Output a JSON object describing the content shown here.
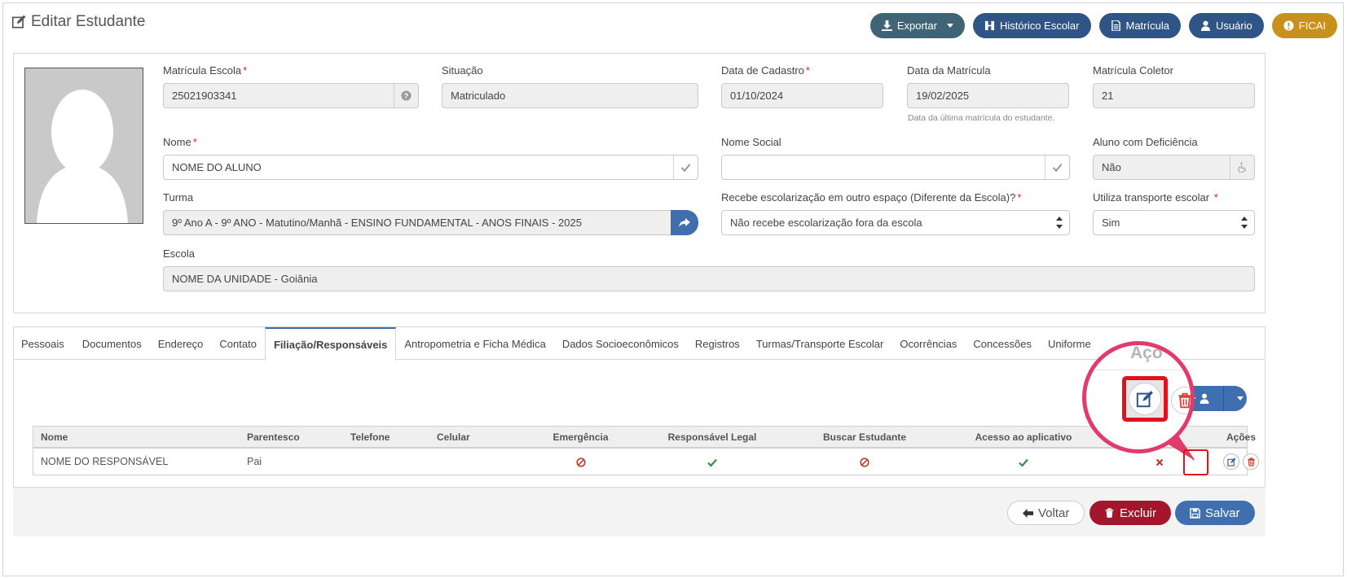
{
  "header": {
    "title": "Editar Estudante",
    "buttons": {
      "exportar": "Exportar",
      "historico": "Histórico Escolar",
      "matricula": "Matrícula",
      "usuario": "Usuário",
      "ficai": "FICAI"
    }
  },
  "form": {
    "matricula_escola": {
      "label": "Matrícula Escola",
      "required": "*",
      "value": "25021903341"
    },
    "situacao": {
      "label": "Situação",
      "value": "Matriculado"
    },
    "data_cadastro": {
      "label": "Data de Cadastro",
      "required": "*",
      "value": "01/10/2024"
    },
    "data_matricula": {
      "label": "Data da Matrícula",
      "value": "19/02/2025",
      "hint": "Data da última matrícula do estudante."
    },
    "matricula_coletor": {
      "label": "Matrícula Coletor",
      "value": "21"
    },
    "nome": {
      "label": "Nome",
      "required": "*",
      "value": "NOME DO ALUNO"
    },
    "nome_social": {
      "label": "Nome Social",
      "value": ""
    },
    "deficiencia": {
      "label": "Aluno com Deficiência",
      "value": "Não"
    },
    "turma": {
      "label": "Turma",
      "value": "9º Ano A - 9º ANO - Matutino/Manhã - ENSINO FUNDAMENTAL - ANOS FINAIS - 2025"
    },
    "escolarizacao": {
      "label": "Recebe escolarização em outro espaço (Diferente da Escola)?",
      "required": "*",
      "value": "Não recebe escolarização fora da escola"
    },
    "transporte": {
      "label": "Utiliza transporte escolar",
      "required": "*",
      "value": "Sim"
    },
    "escola": {
      "label": "Escola",
      "value": "NOME DA UNIDADE - Goiânia"
    }
  },
  "tabs": [
    {
      "label": "Pessoais"
    },
    {
      "label": "Documentos"
    },
    {
      "label": "Endereço"
    },
    {
      "label": "Contato"
    },
    {
      "label": "Filiação/Responsáveis"
    },
    {
      "label": "Antropometria e Ficha Médica"
    },
    {
      "label": "Dados Socioeconômicos"
    },
    {
      "label": "Registros"
    },
    {
      "label": "Turmas/Transporte Escolar"
    },
    {
      "label": "Ocorrências"
    },
    {
      "label": "Concessões"
    },
    {
      "label": "Uniforme"
    }
  ],
  "active_tab": "Filiação/Responsáveis",
  "table": {
    "headers": [
      "Nome",
      "Parentesco",
      "Telefone",
      "Celular",
      "Emergência",
      "Responsável Legal",
      "Buscar Estudante",
      "Acesso ao aplicativo",
      "",
      "Ações"
    ],
    "rows": [
      {
        "nome": "NOME DO RESPONSÁVEL",
        "parentesco": "Pai",
        "telefone": "",
        "celular": "",
        "emergencia": "ban-icon",
        "responsavel_legal": "check-icon",
        "buscar": "ban-icon",
        "acesso": "check-icon",
        "extra": "x-icon"
      }
    ]
  },
  "zoom": {
    "label": "Açõ"
  },
  "footer": {
    "voltar": "Voltar",
    "excluir": "Excluir",
    "salvar": "Salvar"
  },
  "colors": {
    "primary": "#2f5486",
    "dark": "#3f6475",
    "gold": "#c8911b",
    "danger": "#a4162b",
    "blue": "#3f6fae",
    "highlight": "#e0131d",
    "zoom_ring": "#e23a6a"
  }
}
